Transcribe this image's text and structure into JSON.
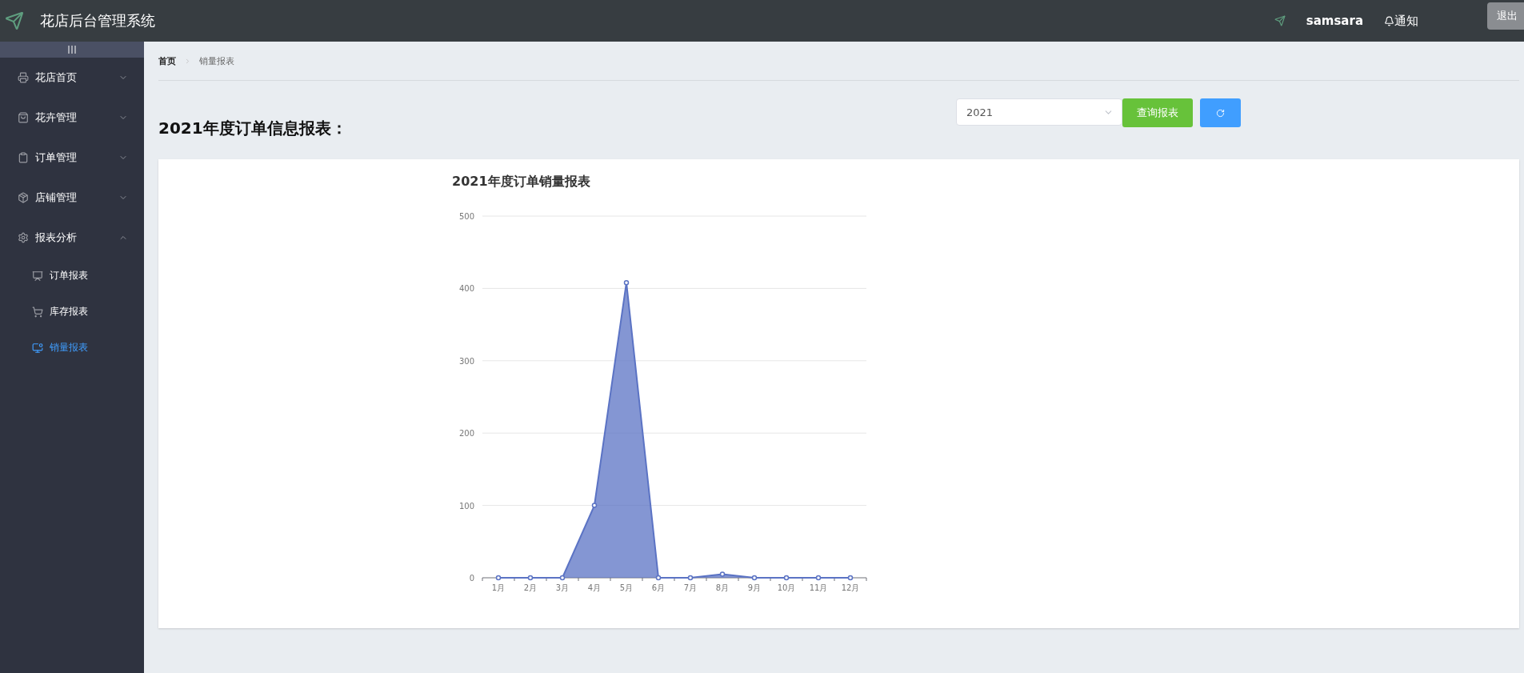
{
  "header": {
    "title": "花店后台管理系统",
    "user": "samsara",
    "notice": "通知",
    "logout": "退出"
  },
  "sidebar": {
    "items": [
      {
        "label": "花店首页",
        "expanded": false
      },
      {
        "label": "花卉管理",
        "expanded": false
      },
      {
        "label": "订单管理",
        "expanded": false
      },
      {
        "label": "店铺管理",
        "expanded": false
      },
      {
        "label": "报表分析",
        "expanded": true,
        "children": [
          {
            "label": "订单报表",
            "selected": false
          },
          {
            "label": "库存报表",
            "selected": false
          },
          {
            "label": "销量报表",
            "selected": true
          }
        ]
      }
    ]
  },
  "breadcrumb": [
    "首页",
    "销量报表"
  ],
  "page_title": "2021年度订单信息报表：",
  "year_select": {
    "value": "2021"
  },
  "query_button": "查询报表",
  "chart": {
    "chart_data": {
      "type": "area",
      "title": "2021年度订单销量报表",
      "categories": [
        "1月",
        "2月",
        "3月",
        "4月",
        "5月",
        "6月",
        "7月",
        "8月",
        "9月",
        "10月",
        "11月",
        "12月"
      ],
      "grid": true,
      "series": [
        {
          "color": "#5b73c4",
          "values": [
            0,
            0,
            0,
            100,
            408,
            0,
            0,
            5,
            0,
            0,
            0,
            0
          ]
        }
      ],
      "ylim": [
        0,
        500
      ],
      "yticks": [
        0,
        100,
        200,
        300,
        400,
        500
      ]
    }
  }
}
